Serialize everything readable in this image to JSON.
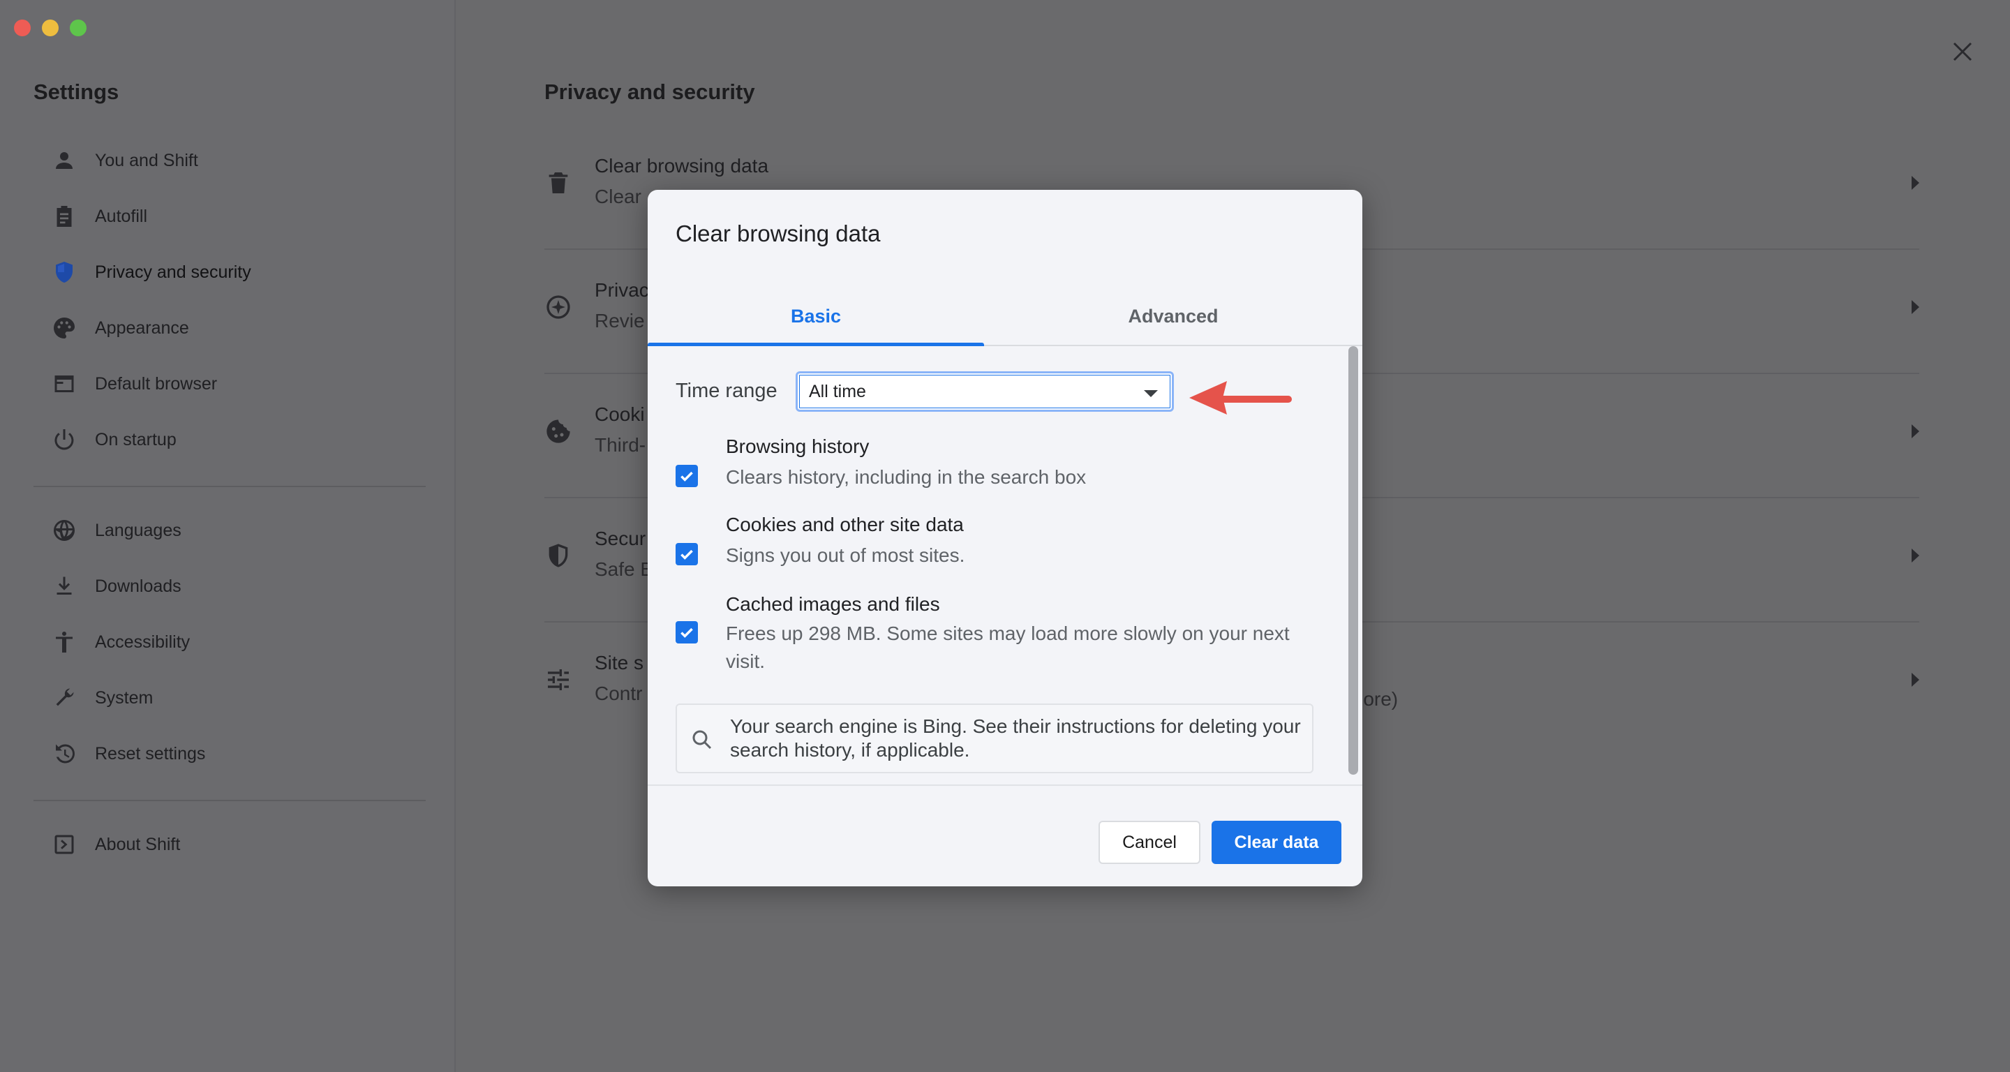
{
  "window": {
    "controls": [
      "close",
      "minimize",
      "maximize"
    ]
  },
  "sidebar": {
    "title": "Settings",
    "items": [
      {
        "label": "You and Shift",
        "icon": "person-icon"
      },
      {
        "label": "Autofill",
        "icon": "clipboard-icon"
      },
      {
        "label": "Privacy and security",
        "icon": "shield-icon",
        "active": true
      },
      {
        "label": "Appearance",
        "icon": "palette-icon"
      },
      {
        "label": "Default browser",
        "icon": "browser-icon"
      },
      {
        "label": "On startup",
        "icon": "power-icon"
      },
      {
        "label": "Languages",
        "icon": "globe-icon"
      },
      {
        "label": "Downloads",
        "icon": "download-icon"
      },
      {
        "label": "Accessibility",
        "icon": "accessibility-icon"
      },
      {
        "label": "System",
        "icon": "wrench-icon"
      },
      {
        "label": "Reset settings",
        "icon": "history-icon"
      },
      {
        "label": "About Shift",
        "icon": "shift-logo-icon"
      }
    ]
  },
  "main": {
    "title": "Privacy and security",
    "rows": [
      {
        "title": "Clear browsing data",
        "subtitle": "Clear",
        "icon": "trash-icon"
      },
      {
        "title": "Privac",
        "subtitle": "Revie",
        "icon": "compass-icon"
      },
      {
        "title": "Cooki",
        "subtitle": "Third-",
        "icon": "cookie-icon"
      },
      {
        "title": "Secur",
        "subtitle": "Safe B",
        "icon": "shield-half-icon"
      },
      {
        "title": "Site s",
        "subtitle": "Contr",
        "subtitle_tail": "more)",
        "icon": "tune-icon"
      }
    ]
  },
  "dialog": {
    "title": "Clear browsing data",
    "tabs": [
      {
        "label": "Basic",
        "selected": true
      },
      {
        "label": "Advanced",
        "selected": false
      }
    ],
    "time_range": {
      "label": "Time range",
      "value": "All time"
    },
    "options": [
      {
        "title": "Browsing history",
        "subtitle": "Clears history, including in the search box",
        "checked": true
      },
      {
        "title": "Cookies and other site data",
        "subtitle": "Signs you out of most sites.",
        "checked": true
      },
      {
        "title": "Cached images and files",
        "subtitle": "Frees up 298 MB. Some sites may load more slowly on your next visit.",
        "checked": true
      }
    ],
    "info": "Your search engine is Bing. See their instructions for deleting your search history, if applicable.",
    "buttons": {
      "cancel": "Cancel",
      "clear": "Clear data"
    }
  },
  "colors": {
    "accent": "#1a73e8",
    "annotation_arrow": "#e5534b",
    "overlay": "#6a6a6c"
  }
}
